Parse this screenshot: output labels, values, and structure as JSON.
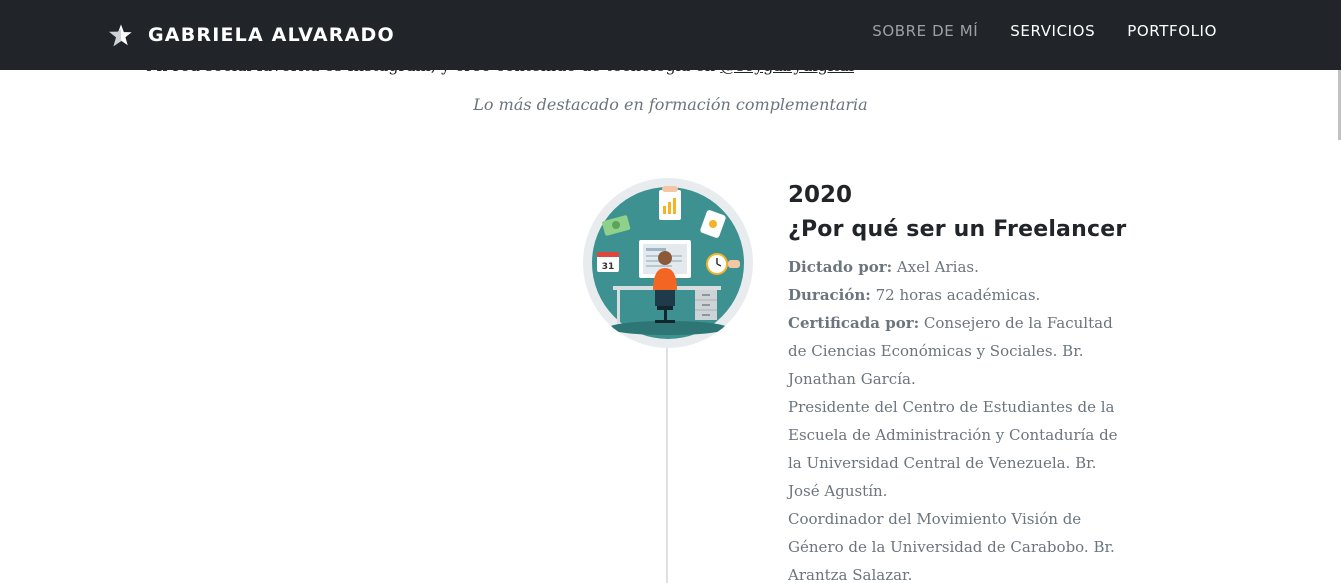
{
  "navbar": {
    "brand": "GABRIELA ALVARADO",
    "items": [
      {
        "label": "SOBRE DE MÍ",
        "active": false
      },
      {
        "label": "SERVICIOS",
        "active": true
      },
      {
        "label": "PORTFOLIO",
        "active": true
      }
    ]
  },
  "hidden_line": {
    "text": "Mi red social favorita es Instagram, y creo contenido de tecnología en ",
    "link": "@soygabydigital"
  },
  "subtitle": "Lo más destacado en formación complementaria",
  "timeline": {
    "year": "2020",
    "title": "¿Por qué ser un Freelancer",
    "dictado_label": "Dictado por:",
    "dictado_value": " Axel Arias.",
    "duracion_label": "Duración:",
    "duracion_value": " 72 horas académicas.",
    "certificada_label": "Certificada por:",
    "certificada_value": " Consejero de la Facultad de Ciencias Económicas y Sociales. Br. Jonathan García.",
    "line2": "Presidente del Centro de Estudiantes de la Escuela de Administración y Contaduría de la Universidad Central de Venezuela. Br. José Agustín.",
    "line3": "Coordinador del Movimiento Visión de Género de la Universidad de Carabobo. Br. Arantza Salazar.",
    "calendar_day": "31"
  },
  "colors": {
    "navbar_bg": "#212529",
    "circle_teal": "#3d9191",
    "shirt_orange": "#f26522"
  }
}
